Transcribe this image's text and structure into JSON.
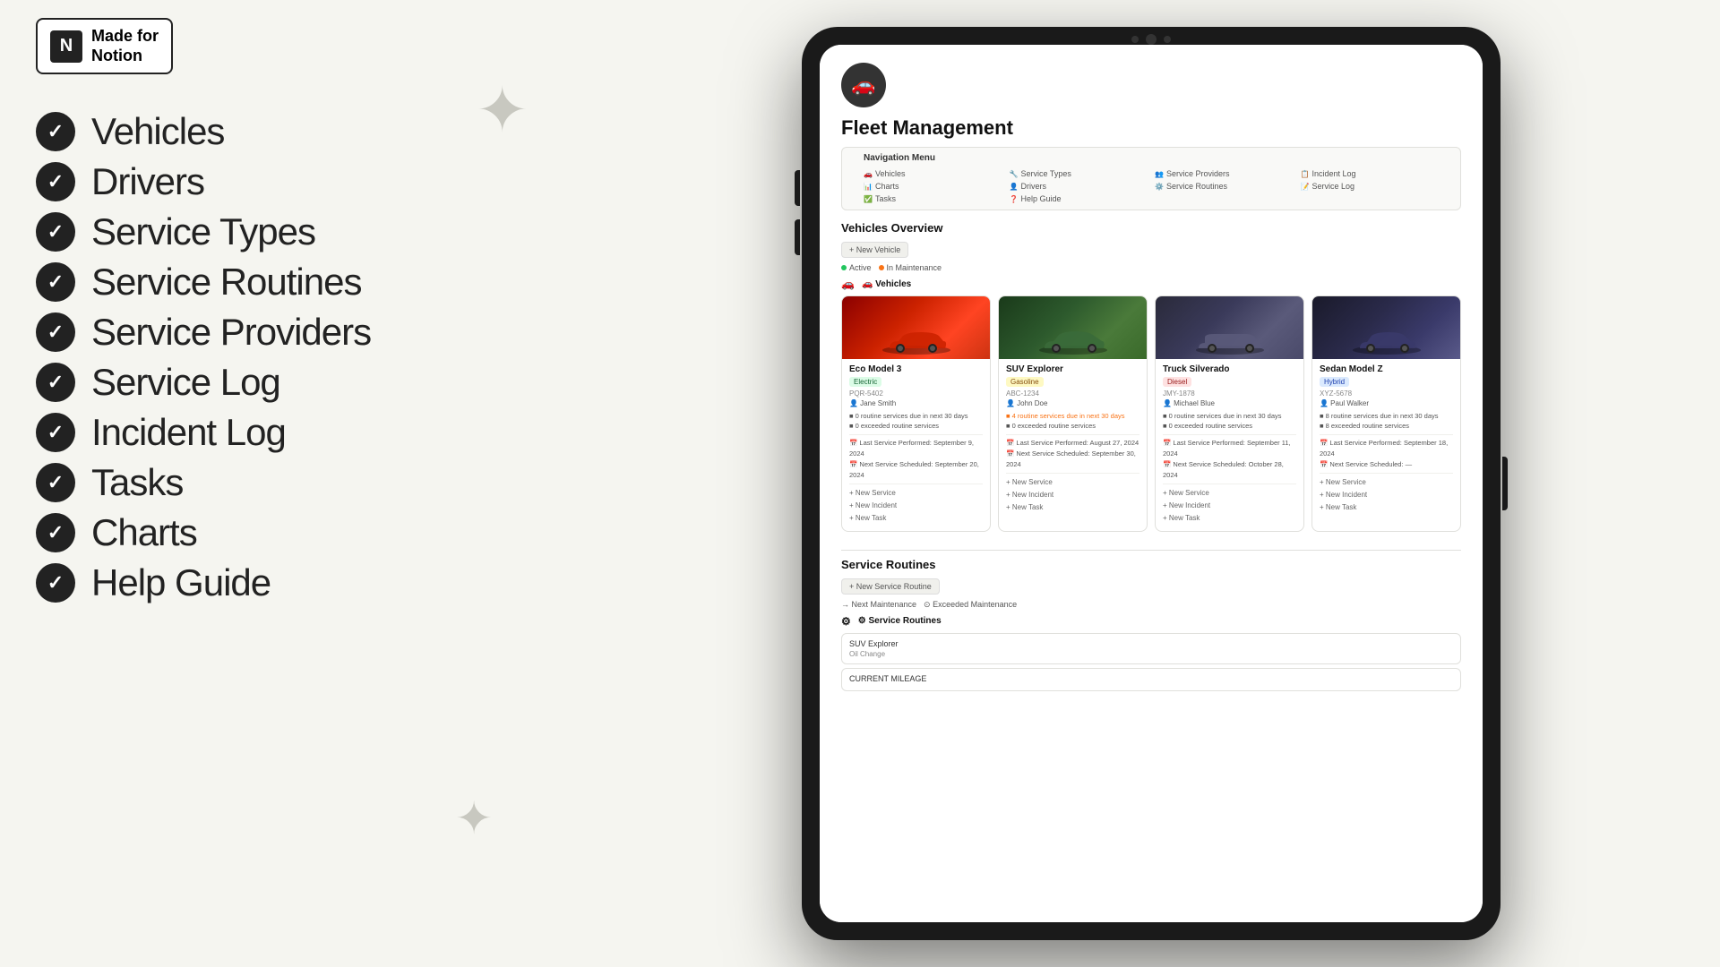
{
  "badge": {
    "icon": "N",
    "line1": "Made for",
    "line2": "Notion"
  },
  "menu_items": [
    {
      "id": "vehicles",
      "label": "Vehicles"
    },
    {
      "id": "drivers",
      "label": "Drivers"
    },
    {
      "id": "service-types",
      "label": "Service Types"
    },
    {
      "id": "service-routines",
      "label": "Service Routines"
    },
    {
      "id": "service-providers",
      "label": "Service Providers"
    },
    {
      "id": "service-log",
      "label": "Service Log"
    },
    {
      "id": "incident-log",
      "label": "Incident Log"
    },
    {
      "id": "tasks",
      "label": "Tasks"
    },
    {
      "id": "charts",
      "label": "Charts"
    },
    {
      "id": "help-guide",
      "label": "Help Guide"
    }
  ],
  "notion_page": {
    "title": "Fleet Management",
    "nav_title": "Navigation Menu",
    "nav_items": [
      {
        "icon": "🚗",
        "label": "Vehicles"
      },
      {
        "icon": "🔧",
        "label": "Service Types"
      },
      {
        "icon": "👥",
        "label": "Service Providers"
      },
      {
        "icon": "📋",
        "label": "Incident Log"
      },
      {
        "icon": "📊",
        "label": "Charts"
      },
      {
        "icon": "👤",
        "label": "Drivers"
      },
      {
        "icon": "⚙️",
        "label": "Service Routines"
      },
      {
        "icon": "📝",
        "label": "Service Log"
      },
      {
        "icon": "✅",
        "label": "Tasks"
      },
      {
        "icon": "❓",
        "label": "Help Guide"
      }
    ],
    "vehicles_section": {
      "title": "Vehicles Overview",
      "new_button": "+ New Vehicle",
      "filters": [
        "✓ Active",
        "⊙ In Maintenance"
      ],
      "vehicles_label": "🚗 Vehicles",
      "vehicles": [
        {
          "name": "Eco Model 3",
          "status": "Electric",
          "status_type": "electric",
          "id": "PQR-5402",
          "driver": "Jane Smith",
          "alerts": "0 routine services due in next 30 days\n0 exceeded routine services",
          "last_service": "Last Service Performed: September 9, 2024",
          "next_service": "Next Service Scheduled: September 20, 2024",
          "actions": [
            "New Service",
            "New Incident",
            "New Task"
          ],
          "img_class": "vehicle-img-red"
        },
        {
          "name": "SUV Explorer",
          "status": "Gasoline",
          "status_type": "gasoline",
          "id": "ABC-1234",
          "driver": "John Doe",
          "alerts": "⚠ 4 routine services due in next 30 days\n0 exceeded routine services",
          "last_service": "Last Service Performed: August 27, 2024",
          "next_service": "Next Service Scheduled: September 30, 2024",
          "actions": [
            "New Service",
            "New Incident",
            "New Task"
          ],
          "img_class": "vehicle-img-suv"
        },
        {
          "name": "Truck Silverado",
          "status": "Diesel",
          "status_type": "diesel",
          "id": "JMY-1878",
          "driver": "Michael Blue",
          "alerts": "0 routine services due in next 30 days\n0 exceeded routine services",
          "last_service": "Last Service Performed: September 11, 2024",
          "next_service": "Next Service Scheduled: October 28, 2024",
          "actions": [
            "New Service",
            "New Incident",
            "New Task"
          ],
          "img_class": "vehicle-img-truck"
        },
        {
          "name": "Sedan Model Z",
          "status": "Hybrid",
          "status_type": "hybrid",
          "id": "XYZ-5678",
          "driver": "Paul Walker",
          "alerts": "8 routine services due in next 30 days\n8 exceeded routine services",
          "last_service": "Last Service Performed: September 18, 2024",
          "next_service": "Next Service Scheduled: —",
          "actions": [
            "New Service",
            "New Incident",
            "New Task"
          ],
          "img_class": "vehicle-img-sedan"
        }
      ]
    },
    "routines_section": {
      "title": "Service Routines",
      "new_button": "+ New Service Routine",
      "filters": [
        "→ Next Maintenance",
        "⊙ Exceeded Maintenance"
      ],
      "routines_label": "⚙ Service Routines",
      "items": [
        {
          "name": "SUV Explorer",
          "detail": "Oil Change"
        },
        {
          "name": "CURRENT MILEAGE",
          "detail": ""
        }
      ]
    }
  }
}
